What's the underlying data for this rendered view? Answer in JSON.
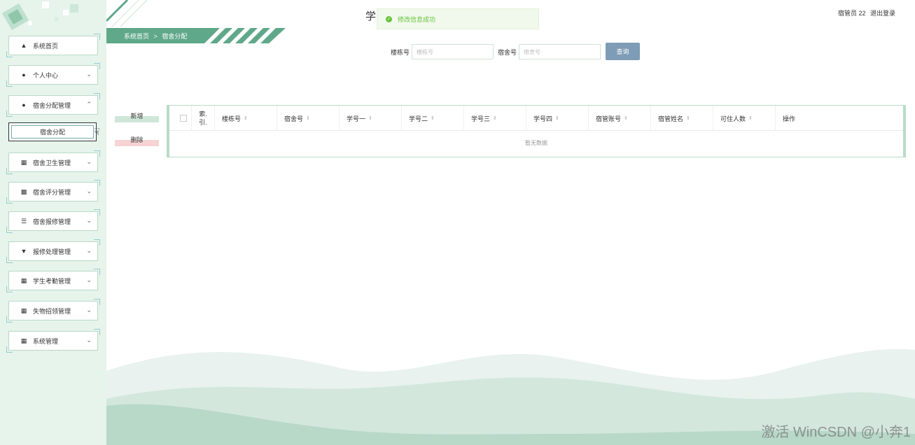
{
  "header": {
    "title": "学",
    "toast": "修改信息成功",
    "user": "宿管员 22",
    "logout": "退出登录"
  },
  "breadcrumb": {
    "home": "系统首页",
    "separator": ">",
    "current": "宿舍分配"
  },
  "sidebar": {
    "items": [
      {
        "label": "系统首页",
        "icon": "home-icon"
      },
      {
        "label": "个人中心",
        "icon": "user-icon"
      },
      {
        "label": "宿舍分配管理",
        "icon": "pin-icon"
      },
      {
        "label": "宿舍卫生管理",
        "icon": "grid-icon"
      },
      {
        "label": "宿舍评分管理",
        "icon": "chart-icon"
      },
      {
        "label": "宿舍报修管理",
        "icon": "list-icon"
      },
      {
        "label": "报修处理管理",
        "icon": "tool-icon"
      },
      {
        "label": "学生考勤管理",
        "icon": "grid-icon"
      },
      {
        "label": "失物招领管理",
        "icon": "grid-icon"
      },
      {
        "label": "系统管理",
        "icon": "grid-icon"
      }
    ],
    "subitem": "宿舍分配"
  },
  "search": {
    "building_label": "楼栋号",
    "building_placeholder": "楼栋号",
    "room_label": "宿舍号",
    "room_placeholder": "宿舍号",
    "query_button": "查询"
  },
  "actions": {
    "add": "新增",
    "delete": "删除"
  },
  "table": {
    "columns": [
      "索引",
      "楼栋号",
      "宿舍号",
      "学号一",
      "学号二",
      "学号三",
      "学号四",
      "宿管账号",
      "宿管姓名",
      "可住人数",
      "操作"
    ],
    "index_line1": "索.",
    "index_line2": "引.",
    "empty_text": "暂无数据"
  },
  "watermark": "激活 WinCSDN @小奔1",
  "colors": {
    "accent": "#5fa889",
    "sidebar_bg": "#e6f4ec",
    "query_button": "#7e9cb5",
    "success": "#67c23a"
  }
}
